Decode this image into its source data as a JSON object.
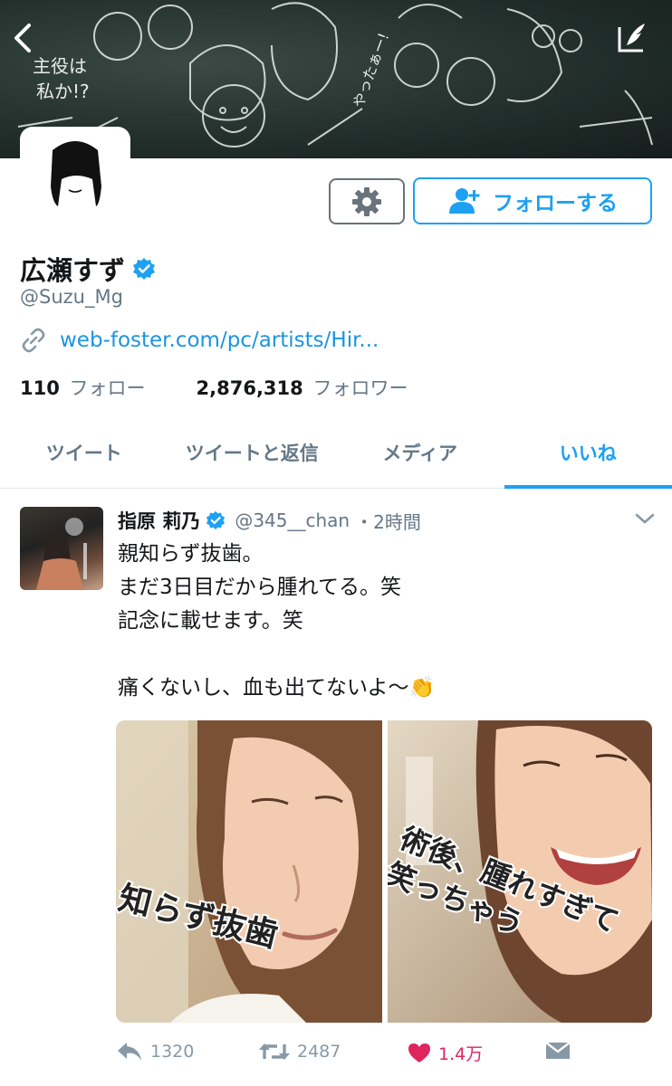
{
  "profile": {
    "name": "広瀬すず",
    "handle": "@Suzu_Mg",
    "website": "web-foster.com/pc/artists/Hir...",
    "following_count": "110",
    "following_label": "フォロー",
    "followers_count": "2,876,318",
    "followers_label": "フォロワー",
    "follow_button_label": "フォローする"
  },
  "banner": {
    "chalk_text_1": "主役は",
    "chalk_text_2": "私か!?",
    "chalk_text_3": "やったぁー!"
  },
  "tabs": [
    {
      "label": "ツイート",
      "active": false
    },
    {
      "label": "ツイートと返信",
      "active": false
    },
    {
      "label": "メディア",
      "active": false
    },
    {
      "label": "いいね",
      "active": true
    }
  ],
  "tweet": {
    "author_name": "指原 莉乃",
    "author_handle": "@345__chan",
    "time": "・2時間",
    "text": "親知らず抜歯。\nまだ3日目だから腫れてる。笑\n記念に載せます。笑\n\n痛くないし、血も出てないよ〜",
    "emoji": "👏",
    "photo_left_caption": "知らず抜歯",
    "photo_right_caption_1": "術後、腫れすぎて",
    "photo_right_caption_2": "笑っちゃう",
    "reply_count": "1320",
    "retweet_count": "2487",
    "like_count": "1.4万"
  },
  "colors": {
    "accent": "#1da1f2",
    "like": "#e0245e",
    "muted": "#657786",
    "link": "#1b95e0"
  },
  "icons": [
    "back-icon",
    "compose-icon",
    "gear-icon",
    "add-user-icon",
    "verified-icon",
    "link-icon",
    "chevron-down-icon",
    "reply-icon",
    "retweet-icon",
    "heart-icon",
    "direct-message-icon"
  ]
}
